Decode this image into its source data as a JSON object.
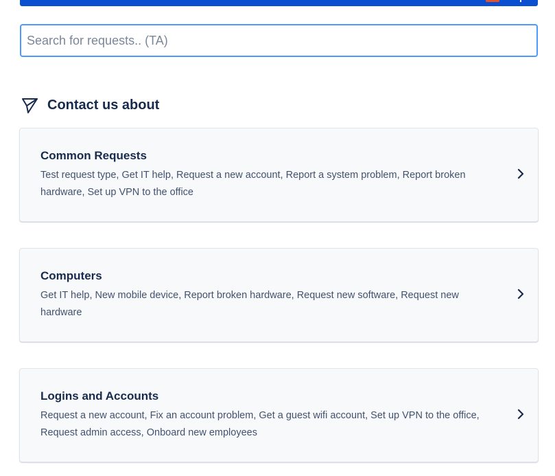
{
  "search": {
    "placeholder": "Search for requests.. (TA)",
    "value": ""
  },
  "section": {
    "title": "Contact us about",
    "icon": "send-icon"
  },
  "groups": [
    {
      "title": "Common Requests",
      "description": "Test request type, Get IT help, Request a new account, Report a system problem, Report broken hardware, Set up VPN to the office"
    },
    {
      "title": "Computers",
      "description": "Get IT help, New mobile device, Report broken hardware, Request new software, Request new hardware"
    },
    {
      "title": "Logins and Accounts",
      "description": "Request a new account, Fix an account problem, Get a guest wifi account, Set up VPN to the office, Request admin access, Onboard new employees"
    }
  ],
  "colors": {
    "brand": "#0b4fd1",
    "focus": "#4c9aff",
    "text": "#172b4d",
    "subtext": "#42526e",
    "card_bg": "#f8f9fb"
  }
}
